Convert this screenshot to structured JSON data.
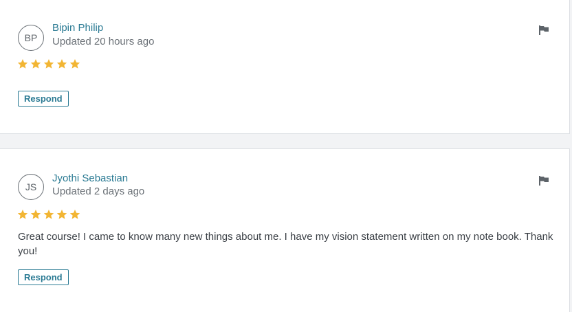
{
  "reviews": [
    {
      "initials": "BP",
      "name": "Bipin Philip",
      "updated": "Updated 20 hours ago",
      "rating": 5,
      "text": "",
      "respond_label": "Respond",
      "flag_icon": "flag-icon"
    },
    {
      "initials": "JS",
      "name": "Jyothi Sebastian",
      "updated": "Updated 2 days ago",
      "rating": 5,
      "text": "Great course! I came to know many new things about me. I have my vision statement written on my note book. Thank you!",
      "respond_label": "Respond",
      "flag_icon": "flag-icon"
    }
  ],
  "colors": {
    "accent": "#2a7a93",
    "star": "#f2b533",
    "background": "#f2f3f5"
  }
}
